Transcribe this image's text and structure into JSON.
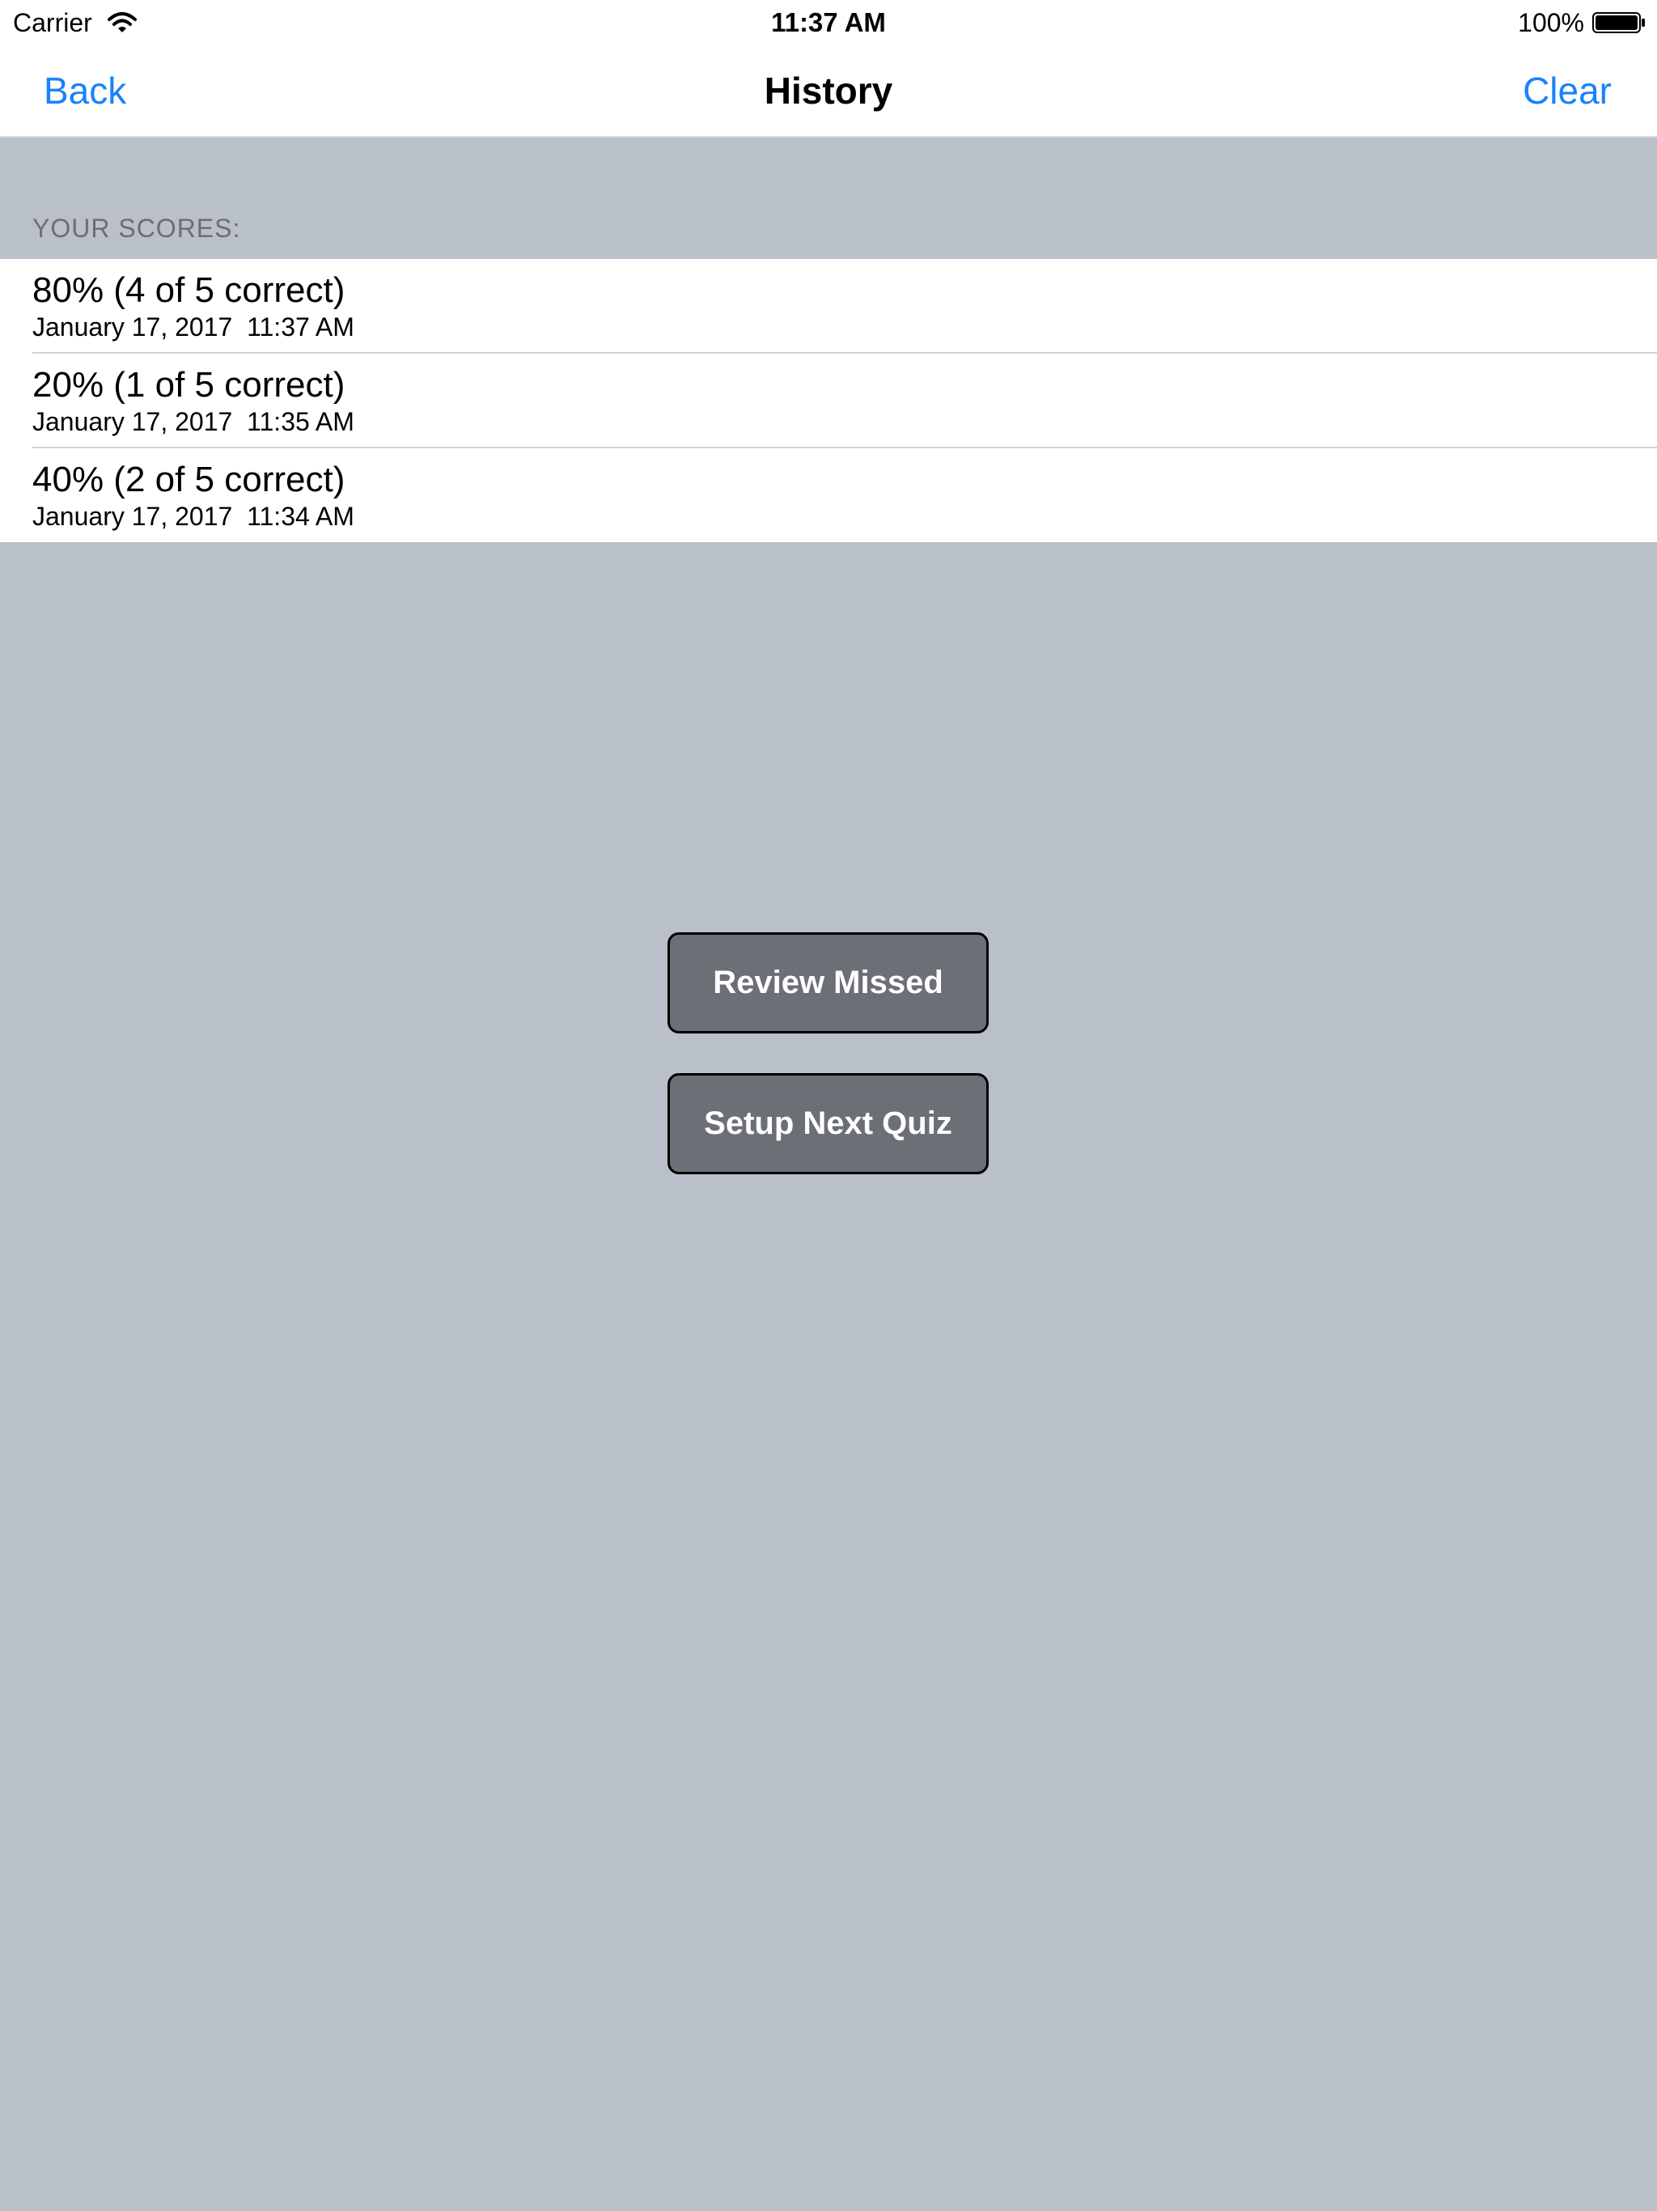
{
  "status_bar": {
    "carrier": "Carrier",
    "time": "11:37 AM",
    "battery_percent": "100%",
    "icons": [
      "wifi-icon",
      "battery-icon"
    ]
  },
  "nav_bar": {
    "back_label": "Back",
    "title": "History",
    "clear_label": "Clear"
  },
  "scores": {
    "section_header": "YOUR SCORES:",
    "items": [
      {
        "title": "80% (4 of 5 correct)",
        "date": "January 17, 2017  11:37 AM"
      },
      {
        "title": "20% (1 of 5 correct)",
        "date": "January 17, 2017  11:35 AM"
      },
      {
        "title": "40% (2 of 5 correct)",
        "date": "January 17, 2017  11:34 AM"
      }
    ]
  },
  "actions": {
    "review_missed_label": "Review Missed",
    "setup_next_quiz_label": "Setup Next Quiz"
  },
  "colors": {
    "accent": "#1a82fb",
    "background": "#b9c0ca",
    "button_fill": "#6c6f76"
  }
}
